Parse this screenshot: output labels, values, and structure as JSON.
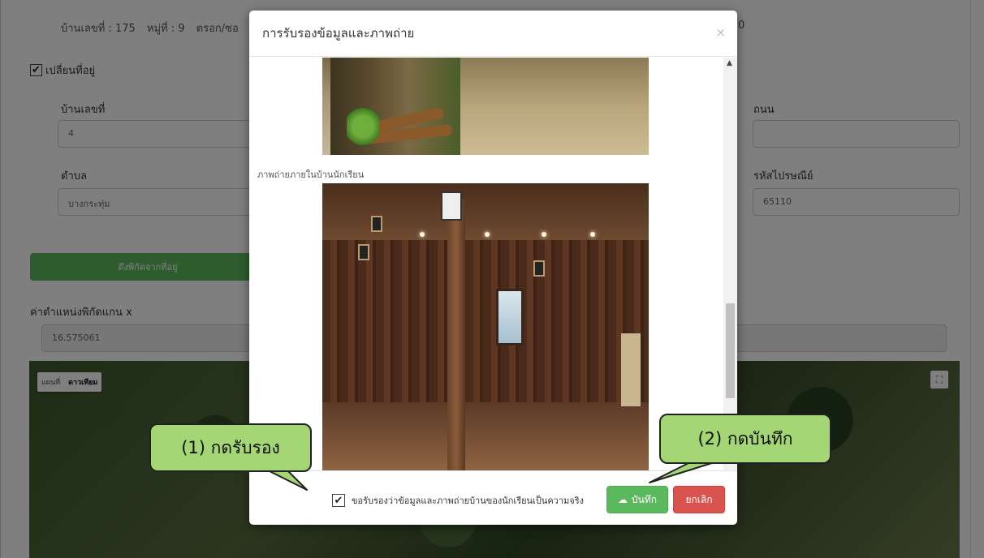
{
  "background": {
    "address": {
      "house_no": "บ้านเลขที่ : 175",
      "moo": "หมู่ที่ : 9",
      "soi": "ตรอก/ซอ",
      "right_fragment": "0"
    },
    "moved_checkbox_label": "เปลี่ยนที่อยู่",
    "labels": {
      "house_no": "บ้านเลขที่",
      "road": "ถนน",
      "subdistrict": "ตำบล",
      "postcode": "รหัสไปรษณีย์",
      "coord_x": "ค่าตำแหน่งพิกัดแกน x"
    },
    "values": {
      "house_no": "4",
      "road": "",
      "subdistrict": "บางกระทุ่ม",
      "postcode": "65110",
      "coord_x": "16.575061"
    },
    "get_coords_button": "ดึงพิกัดจากที่อยู่",
    "map": {
      "tab_map": "แผนที่",
      "tab_satellite": "ดาวเทียม",
      "fullscreen_icon": "fullscreen-icon"
    }
  },
  "modal": {
    "title": "การรับรองข้อมูลและภาพถ่าย",
    "close_icon": "×",
    "photo_caption": "ภาพถ่ายภายในบ้านนักเรียน",
    "certify_label": "ขอรับรองว่าข้อมูลและภาพถ่ายบ้านของนักเรียนเป็นความจริง",
    "save_label": "บันทึก",
    "save_icon": "☁",
    "cancel_label": "ยกเลิก"
  },
  "callouts": {
    "step1": "(1) กดรับรอง",
    "step2": "(2) กดบันทึก",
    "fill_color": "#a5d675"
  }
}
